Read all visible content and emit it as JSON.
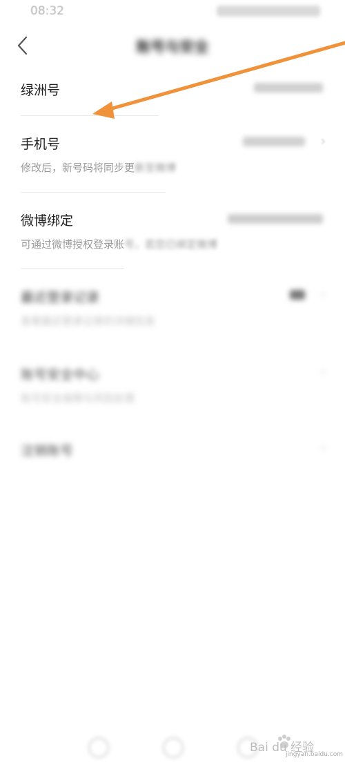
{
  "status_bar": {
    "time": "08:32",
    "icons": ""
  },
  "nav": {
    "title": "账号与安全"
  },
  "rows": {
    "oasis_id": {
      "title": "绿洲号",
      "value": ""
    },
    "phone": {
      "title": "手机号",
      "description": "修改后，新号码将同步更",
      "description_tail": "新至微博",
      "value": ""
    },
    "weibo": {
      "title": "微博绑定",
      "description": "可通过微博授权登录账",
      "description_tail": "号，若您已绑定微博",
      "value": ""
    },
    "recent_login": {
      "title": "最近登录记录",
      "description": "查看最近登录记录的详细信息"
    },
    "security_center": {
      "title": "账号安全中心",
      "description": "账号安全保障与风险处理"
    },
    "deactivate": {
      "title": "注销账号"
    }
  },
  "watermark": {
    "text": "Bai du 经验",
    "subtext": "jingyan.baidu.com"
  },
  "colors": {
    "annotation_arrow": "#f0923a",
    "divider": "#eaeaea",
    "description": "#9a9a9a"
  }
}
